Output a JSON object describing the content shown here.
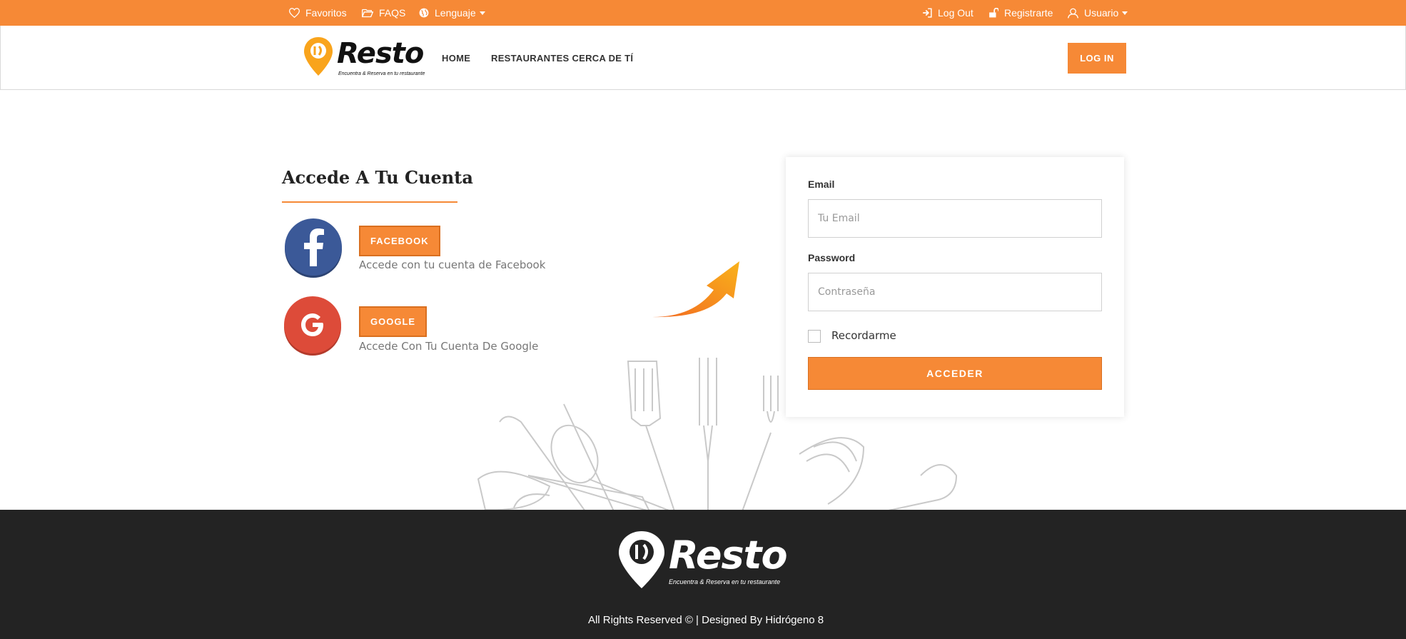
{
  "topbar": {
    "favoritos": "Favoritos",
    "faqs": "FAQS",
    "lenguaje": "Lenguaje",
    "logout": "Log Out",
    "registrarte": "Registrarte",
    "usuario": "Usuario"
  },
  "brand": {
    "name": "Resto",
    "tagline": "Encuentra & Reserva en tu restaurante"
  },
  "nav": {
    "home": "HOME",
    "nearby": "RESTAURANTES CERCA DE TÍ",
    "login": "LOG IN"
  },
  "login_section": {
    "title": "Accede A Tu Cuenta",
    "facebook_button": "FACEBOOK",
    "facebook_desc": "Accede con tu cuenta de Facebook",
    "google_button": "GOOGLE",
    "google_desc": "Accede Con Tu Cuenta De Google"
  },
  "form": {
    "email_label": "Email",
    "email_placeholder": "Tu Email",
    "password_label": "Password",
    "password_placeholder": "Contraseña",
    "remember_label": "Recordarme",
    "submit_label": "ACCEDER"
  },
  "footer": {
    "copyright": "All Rights Reserved © | Designed By Hidrógeno 8"
  },
  "colors": {
    "accent": "#f68936",
    "footer_bg": "#232323",
    "facebook": "#3b5998",
    "google": "#dd4b39"
  }
}
